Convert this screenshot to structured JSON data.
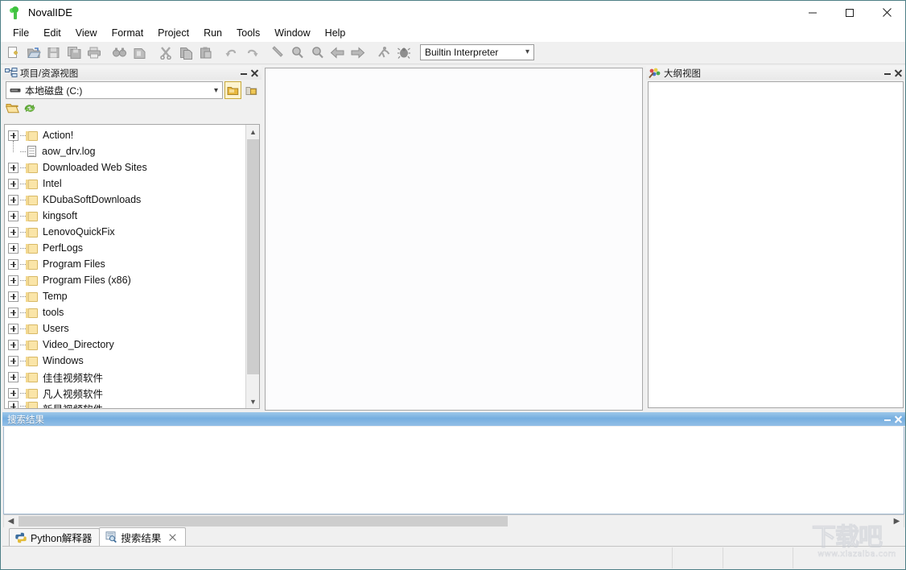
{
  "window": {
    "title": "NovalIDE",
    "app_icon": "sprout-icon",
    "controls": {
      "minimize": "minimize-icon",
      "maximize": "maximize-icon",
      "close": "close-icon"
    }
  },
  "menubar": {
    "items": [
      {
        "label": "File"
      },
      {
        "label": "Edit"
      },
      {
        "label": "View"
      },
      {
        "label": "Format"
      },
      {
        "label": "Project"
      },
      {
        "label": "Run"
      },
      {
        "label": "Tools"
      },
      {
        "label": "Window"
      },
      {
        "label": "Help"
      }
    ]
  },
  "toolbar": {
    "buttons": [
      {
        "name": "new-file-icon"
      },
      {
        "name": "open-file-icon"
      },
      {
        "name": "save-icon"
      },
      {
        "name": "save-all-icon"
      },
      {
        "name": "print-icon"
      },
      {
        "name": "find-in-files-icon"
      },
      {
        "name": "goto-icon"
      },
      {
        "name": "cut-icon"
      },
      {
        "name": "copy-icon"
      },
      {
        "name": "paste-icon"
      },
      {
        "name": "undo-icon"
      },
      {
        "name": "redo-icon"
      },
      {
        "name": "wrench-icon"
      },
      {
        "name": "zoom-in-icon"
      },
      {
        "name": "zoom-out-icon"
      },
      {
        "name": "back-arrow-icon"
      },
      {
        "name": "forward-arrow-icon"
      },
      {
        "name": "run-icon"
      },
      {
        "name": "debug-bug-icon"
      }
    ],
    "interpreter_combo": {
      "value": "Builtin Interpreter",
      "caret": "chevron-down-icon"
    }
  },
  "project_panel": {
    "title": "项目/资源视图",
    "icon": "project-view-icon",
    "minimize": "minimize-icon",
    "close": "close-icon",
    "drive_combo": {
      "value": "本地磁盘 (C:)",
      "icon": "drive-icon",
      "caret": "chevron-down-icon"
    },
    "header_buttons": [
      {
        "name": "project-folder-button",
        "selected": true
      },
      {
        "name": "package-folder-button",
        "selected": false
      }
    ],
    "row2_buttons": [
      {
        "name": "open-folder-icon"
      },
      {
        "name": "refresh-icon"
      }
    ],
    "tree": [
      {
        "label": "Action!",
        "type": "folder",
        "expandable": true
      },
      {
        "label": "aow_drv.log",
        "type": "file",
        "expandable": false
      },
      {
        "label": "Downloaded Web Sites",
        "type": "folder",
        "expandable": true
      },
      {
        "label": "Intel",
        "type": "folder",
        "expandable": true
      },
      {
        "label": "KDubaSoftDownloads",
        "type": "folder",
        "expandable": true
      },
      {
        "label": "kingsoft",
        "type": "folder",
        "expandable": true
      },
      {
        "label": "LenovoQuickFix",
        "type": "folder",
        "expandable": true
      },
      {
        "label": "PerfLogs",
        "type": "folder",
        "expandable": true
      },
      {
        "label": "Program Files",
        "type": "folder",
        "expandable": true
      },
      {
        "label": "Program Files (x86)",
        "type": "folder",
        "expandable": true
      },
      {
        "label": "Temp",
        "type": "folder",
        "expandable": true
      },
      {
        "label": "tools",
        "type": "folder",
        "expandable": true
      },
      {
        "label": "Users",
        "type": "folder",
        "expandable": true
      },
      {
        "label": "Video_Directory",
        "type": "folder",
        "expandable": true
      },
      {
        "label": "Windows",
        "type": "folder",
        "expandable": true
      },
      {
        "label": "佳佳视频软件",
        "type": "folder",
        "expandable": true
      },
      {
        "label": "凡人视频软件",
        "type": "folder",
        "expandable": true
      },
      {
        "label": "新星视频软件",
        "type": "folder",
        "expandable": true
      }
    ],
    "scrollbar": {
      "up": "chevron-up-icon",
      "down": "chevron-down-icon"
    }
  },
  "editor": {
    "content": ""
  },
  "outline_panel": {
    "title": "大纲视图",
    "icon": "outline-view-icon",
    "minimize": "minimize-icon",
    "close": "close-icon",
    "content": ""
  },
  "search_panel": {
    "title": "搜索结果",
    "active": true,
    "minimize": "minimize-icon",
    "close": "close-icon",
    "content": "",
    "hscroll": {
      "left": "chevron-left-icon",
      "right": "chevron-right-icon"
    }
  },
  "bottom_tabs": [
    {
      "label": "Python解释器",
      "icon": "python-icon",
      "active": false,
      "closable": false
    },
    {
      "label": "搜索结果",
      "icon": "search-results-icon",
      "active": true,
      "closable": true,
      "close": "close-icon"
    }
  ],
  "statusbar": {
    "cells": [
      "",
      "",
      "",
      ""
    ]
  },
  "watermark": {
    "big": "下载吧",
    "small": "www.xiazaiba.com"
  },
  "colors": {
    "accent_blue": "#76aee0",
    "window_border": "#4e7f86",
    "chrome": "#f0f0f0",
    "folder_yellow": "#fae5a8"
  }
}
